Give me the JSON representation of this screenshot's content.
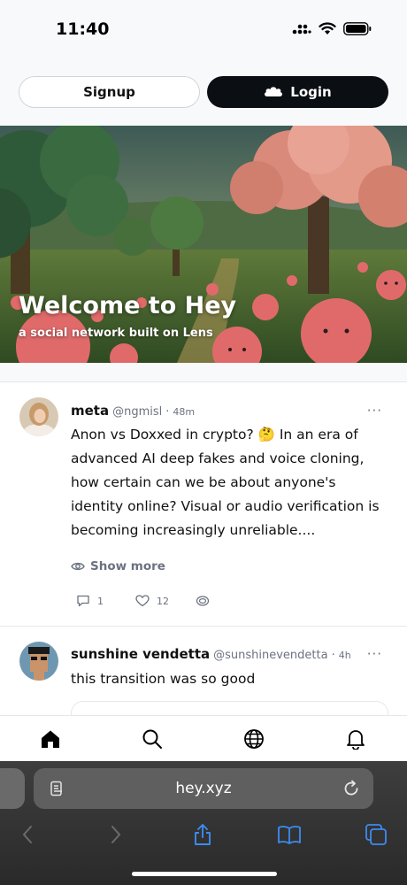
{
  "status_bar": {
    "time": "11:40"
  },
  "header": {
    "signup_label": "Signup",
    "login_label": "Login"
  },
  "hero": {
    "title": "Welcome to Hey",
    "subtitle": "a social network built on Lens"
  },
  "posts": [
    {
      "display_name": "meta",
      "handle": "@ngmisl",
      "separator": "·",
      "time": "48m",
      "more": "···",
      "content": "Anon vs Doxxed in crypto? 🤔 In an era of advanced AI deep fakes and voice cloning, how certain can we be about anyone's identity online? Visual or audio verification is becoming increasingly unreliable....",
      "show_more_label": "Show more",
      "comments": "1",
      "likes": "12"
    },
    {
      "display_name": "sunshine vendetta",
      "handle": "@sunshinevendetta",
      "separator": "·",
      "time": "4h",
      "more": "···",
      "content": "this transition was so good"
    }
  ],
  "browser": {
    "url": "hey.xyz"
  },
  "icons": {
    "tabbar": [
      "home-icon",
      "search-icon",
      "globe-icon",
      "bell-icon"
    ],
    "browser": [
      "reader-icon",
      "reload-icon",
      "back-icon",
      "forward-icon",
      "share-icon",
      "bookmarks-icon",
      "tabs-icon"
    ]
  },
  "colors": {
    "login_bg": "#0b0f14",
    "accent_blue": "#3b8cf0"
  }
}
